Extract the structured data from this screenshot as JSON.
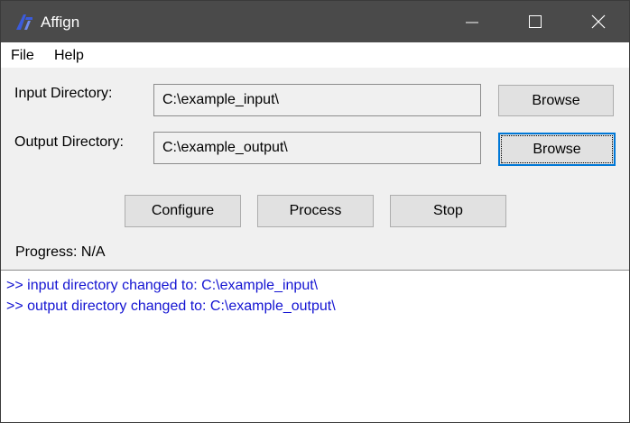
{
  "window": {
    "title": "Affign",
    "icon": "affign-logo-icon",
    "controls": [
      "minimize-icon",
      "maximize-icon",
      "close-icon"
    ]
  },
  "menu": {
    "file": "File",
    "help": "Help"
  },
  "input": {
    "label": "Input Directory:",
    "value": "C:\\example_input\\",
    "browse_label": "Browse"
  },
  "output": {
    "label": "Output Directory:",
    "value": "C:\\example_output\\",
    "browse_label": "Browse"
  },
  "actions": {
    "configure": "Configure",
    "process": "Process",
    "stop": "Stop"
  },
  "progress": {
    "text": "Progress: N/A"
  },
  "log": {
    "lines": [
      ">> input directory changed to: C:\\example_input\\",
      ">> output directory changed to: C:\\example_output\\"
    ]
  },
  "colors": {
    "titlebar": "#4a4a4a",
    "log_text": "#1414d2",
    "focus_border": "#0078d7"
  }
}
